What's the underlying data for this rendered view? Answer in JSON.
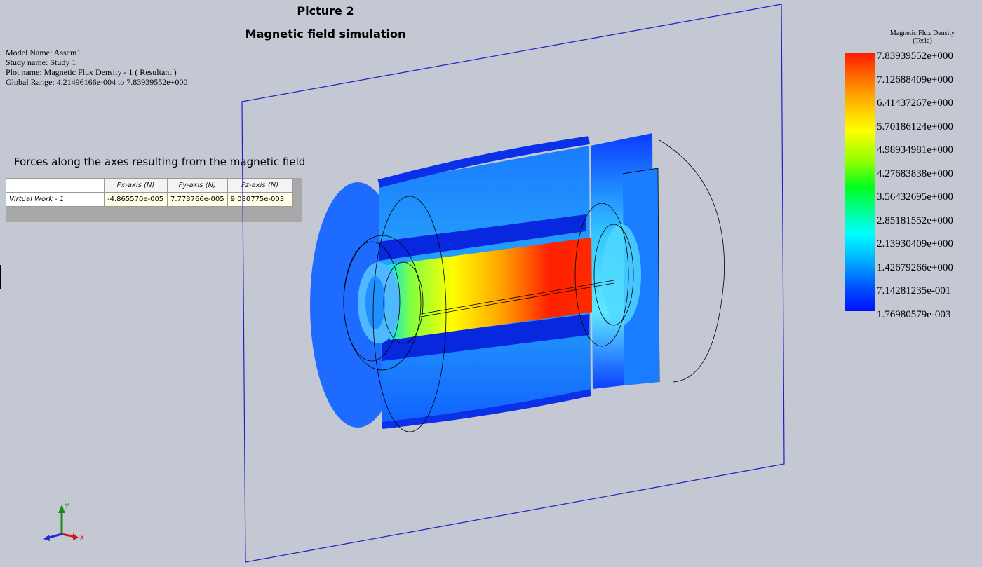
{
  "header": {
    "picture_title": "Picture 2",
    "simulation_title": "Magnetic field simulation"
  },
  "model_info": {
    "model_name": "Model Name: Assem1",
    "study_name": "Study name: Study 1",
    "plot_name": "Plot name: Magnetic Flux Density - 1 ( Resultant )",
    "global_range": "Global Range: 4.21496166e-004 to 7.83939552e+000"
  },
  "forces": {
    "caption": "Forces along the axes resulting from the magnetic field",
    "columns": [
      "",
      "Fx-axis (N)",
      "Fy-axis (N)",
      "Fz-axis (N)"
    ],
    "rows": [
      {
        "name": "Virtual Work - 1",
        "fx": "-4.865570e-005",
        "fy": "7.773766e-005",
        "fz": "9.080775e-003"
      }
    ]
  },
  "legend": {
    "title_line1": "Magnetic Flux Density",
    "title_line2": "(Tesla)",
    "labels": [
      "7.83939552e+000",
      "7.12688409e+000",
      "6.41437267e+000",
      "5.70186124e+000",
      "4.98934981e+000",
      "4.27683838e+000",
      "3.56432695e+000",
      "2.85181552e+000",
      "2.13930409e+000",
      "1.42679266e+000",
      "7.14281235e-001",
      "1.76980579e-003"
    ]
  },
  "triad": {
    "x_label": "X",
    "y_label": "Y"
  },
  "colors": {
    "background": "#c4c8d2",
    "plane_outline": "#2020c8",
    "max": "#ff1a00",
    "min": "#0010ff"
  }
}
